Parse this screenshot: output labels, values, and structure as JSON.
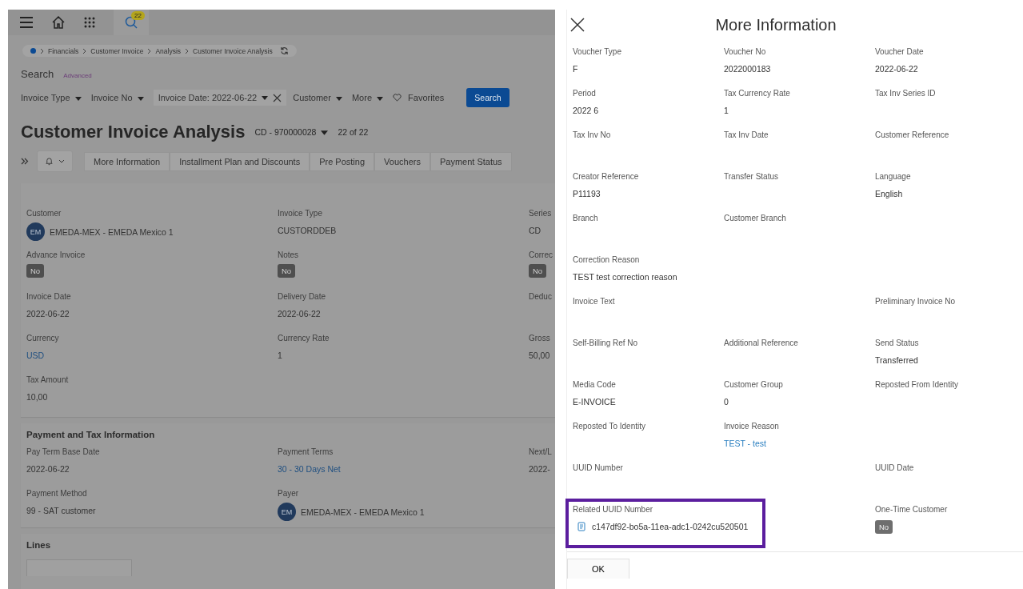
{
  "topbar": {
    "badge": "22"
  },
  "breadcrumb": [
    "Financials",
    "Customer Invoice",
    "Analysis",
    "Customer Invoice Analysis"
  ],
  "search": {
    "title": "Search",
    "advanced": "Advanced",
    "button": "Search",
    "favorites": "Favorites"
  },
  "filters": [
    {
      "label": "Invoice Type",
      "kind": "dropdown"
    },
    {
      "label": "Invoice No",
      "kind": "dropdown"
    },
    {
      "label": "Invoice Date: 2022-06-22",
      "kind": "chip"
    },
    {
      "label": "Customer",
      "kind": "dropdown"
    },
    {
      "label": "More",
      "kind": "dropdown"
    }
  ],
  "page": {
    "title": "Customer Invoice Analysis",
    "record": "CD - 970000028",
    "count": "22 of 22"
  },
  "toolbar": [
    "More Information",
    "Installment Plan and Discounts",
    "Pre Posting",
    "Vouchers",
    "Payment Status"
  ],
  "main_fields": [
    {
      "label": "Customer",
      "value": "EMEDA-MEX - EMEDA Mexico 1",
      "initials": "EM",
      "kind": "avatar"
    },
    {
      "label": "Invoice Type",
      "value": "CUSTORDDEB",
      "kind": "text"
    },
    {
      "label": "Series",
      "value": "CD",
      "kind": "text"
    },
    {
      "label": "Advance Invoice",
      "value": "No",
      "kind": "toggle"
    },
    {
      "label": "Notes",
      "value": "No",
      "kind": "toggle"
    },
    {
      "label": "Correc",
      "value": "No",
      "kind": "toggle"
    },
    {
      "label": "Invoice Date",
      "value": "2022-06-22",
      "kind": "text"
    },
    {
      "label": "Delivery Date",
      "value": "2022-06-22",
      "kind": "text"
    },
    {
      "label": "Deduc",
      "kind": "text"
    },
    {
      "label": "Currency",
      "value": "USD",
      "kind": "link"
    },
    {
      "label": "Currency Rate",
      "value": "1",
      "kind": "text"
    },
    {
      "label": "Gross",
      "value": "50,00",
      "kind": "text"
    },
    {
      "label": "Tax Amount",
      "value": "10,00",
      "kind": "text"
    }
  ],
  "payment": {
    "title": "Payment and Tax Information",
    "fields": [
      {
        "label": "Pay Term Base Date",
        "value": "2022-06-22",
        "kind": "text"
      },
      {
        "label": "Payment Terms",
        "value": "30 - 30 Days Net",
        "kind": "link"
      },
      {
        "label": "Next/L",
        "value": "2022-",
        "kind": "text"
      },
      {
        "label": "Payment Method",
        "value": "99 - SAT customer",
        "kind": "text"
      },
      {
        "label": "Payer",
        "value": "EMEDA-MEX - EMEDA Mexico 1",
        "initials": "EM",
        "kind": "avatar"
      }
    ]
  },
  "lines": {
    "title": "Lines"
  },
  "dialog": {
    "title": "More Information",
    "ok": "OK",
    "fields": [
      {
        "label": "Voucher Type",
        "value": "F",
        "kind": "text",
        "highlighted": false
      },
      {
        "label": "Voucher No",
        "value": "2022000183",
        "kind": "text",
        "highlighted": false
      },
      {
        "label": "Voucher Date",
        "value": "2022-06-22",
        "kind": "text",
        "highlighted": false
      },
      {
        "label": "Period",
        "value": "2022 6",
        "kind": "text",
        "highlighted": false
      },
      {
        "label": "Tax Currency Rate",
        "value": "1",
        "kind": "text",
        "highlighted": false
      },
      {
        "label": "Tax Inv Series ID",
        "kind": "text",
        "highlighted": false
      },
      {
        "label": "Tax Inv No",
        "kind": "text",
        "highlighted": false
      },
      {
        "label": "Tax Inv Date",
        "kind": "text",
        "highlighted": false
      },
      {
        "label": "Customer Reference",
        "kind": "text",
        "highlighted": false
      },
      {
        "label": "Creator Reference",
        "value": "P11193",
        "kind": "text",
        "highlighted": false
      },
      {
        "label": "Transfer Status",
        "kind": "text",
        "highlighted": false
      },
      {
        "label": "Language",
        "value": "English",
        "kind": "text",
        "highlighted": false
      },
      {
        "label": "Branch",
        "kind": "text",
        "highlighted": false
      },
      {
        "label": "Customer Branch",
        "kind": "text",
        "highlighted": false
      },
      {
        "kind": "empty",
        "highlighted": false
      },
      {
        "label": "Correction Reason",
        "value": "TEST test correction reason",
        "kind": "text",
        "highlighted": false
      },
      {
        "kind": "empty",
        "highlighted": false
      },
      {
        "kind": "empty",
        "highlighted": false
      },
      {
        "label": "Invoice Text",
        "kind": "text",
        "highlighted": false
      },
      {
        "kind": "empty",
        "highlighted": false
      },
      {
        "label": "Preliminary Invoice No",
        "kind": "text",
        "highlighted": false
      },
      {
        "label": "Self-Billing Ref No",
        "kind": "text",
        "highlighted": false
      },
      {
        "label": "Additional Reference",
        "kind": "text",
        "highlighted": false
      },
      {
        "label": "Send Status",
        "value": "Transferred",
        "kind": "text",
        "highlighted": false
      },
      {
        "label": "Media Code",
        "value": "E-INVOICE",
        "kind": "text",
        "highlighted": false
      },
      {
        "label": "Customer Group",
        "value": "0",
        "kind": "text",
        "highlighted": false
      },
      {
        "label": "Reposted From Identity",
        "kind": "text",
        "highlighted": false
      },
      {
        "label": "Reposted To Identity",
        "kind": "text",
        "highlighted": false
      },
      {
        "label": "Invoice Reason",
        "value": "TEST - test",
        "kind": "link",
        "highlighted": false
      },
      {
        "kind": "empty",
        "highlighted": false
      },
      {
        "label": "UUID Number",
        "kind": "text",
        "highlighted": false
      },
      {
        "kind": "empty",
        "highlighted": false
      },
      {
        "label": "UUID Date",
        "kind": "text",
        "highlighted": false
      },
      {
        "label": "Related UUID Number",
        "value": "c147df92-bo5a-11ea-adc1-0242cu520501",
        "kind": "file",
        "highlighted": true
      },
      {
        "kind": "empty",
        "highlighted": false
      },
      {
        "label": "One-Time Customer",
        "value": "No",
        "kind": "toggle",
        "highlighted": false
      }
    ]
  }
}
